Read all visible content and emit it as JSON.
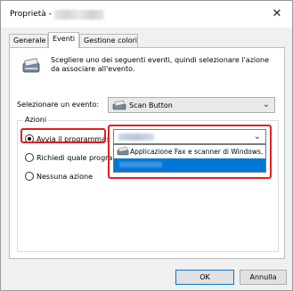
{
  "window": {
    "title": "Proprietà -",
    "close_glyph": "✕"
  },
  "tabs": [
    {
      "label": "Generale"
    },
    {
      "label": "Eventi"
    },
    {
      "label": "Gestione colori"
    }
  ],
  "panel": {
    "description": "Scegliere uno dei seguenti eventi, quindi selezionare l'azione da associare all'evento.",
    "select_event_label": "Selezionare un evento:",
    "event_value": "Scan Button",
    "group_label": "Azioni",
    "radio_start_program": "Avvia il programma:",
    "radio_ask_program": "Richiedi quale programma",
    "radio_no_action": "Nessuna azione",
    "dropdown_option_1": "Applicazione Fax e scanner di Windows."
  },
  "buttons": {
    "ok": "OK",
    "cancel": "Annulla"
  },
  "colors": {
    "highlight_red": "#e02020",
    "selection_blue": "#0078d7"
  },
  "icons": {
    "scanner": "scanner-icon",
    "chevron": "chevron-down-icon",
    "close": "close-icon"
  }
}
